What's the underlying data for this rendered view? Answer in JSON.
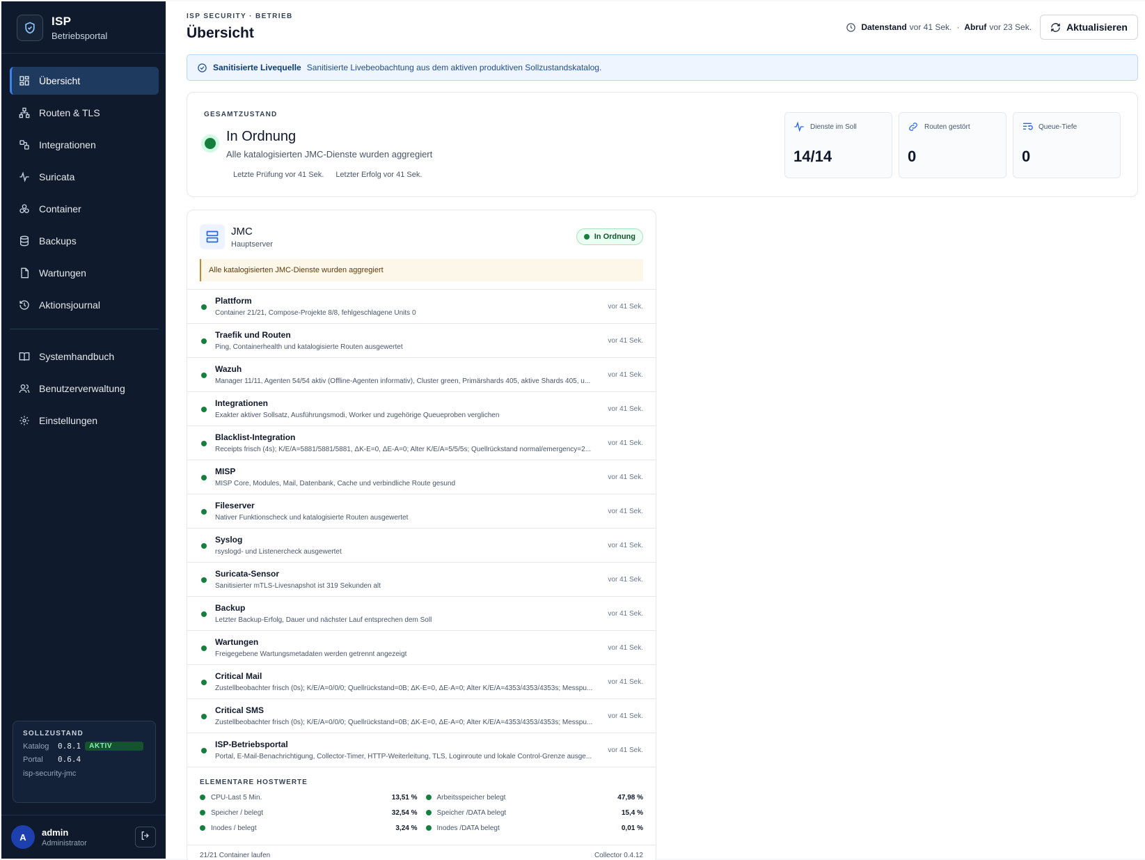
{
  "brand": {
    "title": "ISP",
    "subtitle": "Betriebsportal"
  },
  "nav": {
    "primary": [
      {
        "label": "Übersicht",
        "icon": "dashboard-icon",
        "active": true
      },
      {
        "label": "Routen & TLS",
        "icon": "network-icon"
      },
      {
        "label": "Integrationen",
        "icon": "integrations-icon"
      },
      {
        "label": "Suricata",
        "icon": "activity-icon"
      },
      {
        "label": "Container",
        "icon": "containers-icon"
      },
      {
        "label": "Backups",
        "icon": "database-icon"
      },
      {
        "label": "Wartungen",
        "icon": "document-icon"
      },
      {
        "label": "Aktionsjournal",
        "icon": "history-icon"
      }
    ],
    "secondary": [
      {
        "label": "Systemhandbuch",
        "icon": "book-icon"
      },
      {
        "label": "Benutzerverwaltung",
        "icon": "users-icon"
      },
      {
        "label": "Einstellungen",
        "icon": "gear-icon"
      }
    ]
  },
  "sollzustand": {
    "title": "SOLLZUSTAND",
    "katalog_label": "Katalog",
    "katalog_version": "0.8.1",
    "katalog_badge": "AKTIV",
    "portal_label": "Portal",
    "portal_version": "0.6.4",
    "host": "isp-security-jmc"
  },
  "user": {
    "initial": "A",
    "name": "admin",
    "role": "Administrator"
  },
  "header": {
    "kicker": "ISP SECURITY · BETRIEB",
    "title": "Übersicht",
    "datenstand_label": "Datenstand",
    "datenstand_value": "vor 41 Sek.",
    "sep": "·",
    "abruf_label": "Abruf",
    "abruf_value": "vor 23 Sek.",
    "refresh_label": "Aktualisieren"
  },
  "banner": {
    "title": "Sanitisierte Livequelle",
    "text": "Sanitisierte Livebeobachtung aus dem aktiven produktiven Sollzustandskatalog."
  },
  "overall": {
    "label": "GESAMTZUSTAND",
    "status": "In Ordnung",
    "description": "Alle katalogisierten JMC-Dienste wurden aggregiert",
    "last_check": "Letzte Prüfung vor 41 Sek.",
    "last_success": "Letzter Erfolg vor 41 Sek.",
    "kpis": [
      {
        "label": "Dienste im Soll",
        "value": "14/14",
        "icon": "pulse-icon"
      },
      {
        "label": "Routen gestört",
        "value": "0",
        "icon": "link-icon"
      },
      {
        "label": "Queue-Tiefe",
        "value": "0",
        "icon": "queue-icon"
      }
    ]
  },
  "host": {
    "name": "JMC",
    "role": "Hauptserver",
    "status": "In Ordnung",
    "note": "Alle katalogisierten JMC-Dienste wurden aggregiert",
    "checks": [
      {
        "name": "Plattform",
        "desc": "Container 21/21, Compose-Projekte 8/8, fehlgeschlagene Units 0",
        "time": "vor 41 Sek."
      },
      {
        "name": "Traefik und Routen",
        "desc": "Ping, Containerhealth und katalogisierte Routen ausgewertet",
        "time": "vor 41 Sek."
      },
      {
        "name": "Wazuh",
        "desc": "Manager 11/11, Agenten 54/54 aktiv (Offline-Agenten informativ), Cluster green, Primärshards 405, aktive Shards 405, u...",
        "time": "vor 41 Sek."
      },
      {
        "name": "Integrationen",
        "desc": "Exakter aktiver Sollsatz, Ausführungsmodi, Worker und zugehörige Queueproben verglichen",
        "time": "vor 41 Sek."
      },
      {
        "name": "Blacklist-Integration",
        "desc": "Receipts frisch (4s); K/E/A=5881/5881/5881, ΔK-E=0, ΔE-A=0; Alter K/E/A=5/5/5s; Quellrückstand normal/emergency=2...",
        "time": "vor 41 Sek."
      },
      {
        "name": "MISP",
        "desc": "MISP Core, Modules, Mail, Datenbank, Cache und verbindliche Route gesund",
        "time": "vor 41 Sek."
      },
      {
        "name": "Fileserver",
        "desc": "Nativer Funktionscheck und katalogisierte Routen ausgewertet",
        "time": "vor 41 Sek."
      },
      {
        "name": "Syslog",
        "desc": "rsyslogd- und Listenercheck ausgewertet",
        "time": "vor 41 Sek."
      },
      {
        "name": "Suricata-Sensor",
        "desc": "Sanitisierter mTLS-Livesnapshot ist 319 Sekunden alt",
        "time": "vor 41 Sek."
      },
      {
        "name": "Backup",
        "desc": "Letzter Backup-Erfolg, Dauer und nächster Lauf entsprechen dem Soll",
        "time": "vor 41 Sek."
      },
      {
        "name": "Wartungen",
        "desc": "Freigegebene Wartungsmetadaten werden getrennt angezeigt",
        "time": "vor 41 Sek."
      },
      {
        "name": "Critical Mail",
        "desc": "Zustellbeobachter frisch (0s); K/E/A=0/0/0; Quellrückstand=0B; ΔK-E=0, ΔE-A=0; Alter K/E/A=4353/4353/4353s; Messpu...",
        "time": "vor 41 Sek."
      },
      {
        "name": "Critical SMS",
        "desc": "Zustellbeobachter frisch (0s); K/E/A=0/0/0; Quellrückstand=0B; ΔK-E=0, ΔE-A=0; Alter K/E/A=4353/4353/4353s; Messpu...",
        "time": "vor 41 Sek."
      },
      {
        "name": "ISP-Betriebsportal",
        "desc": "Portal, E-Mail-Benachrichtigung, Collector-Timer, HTTP-Weiterleitung, TLS, Loginroute und lokale Control-Grenze ausge...",
        "time": "vor 41 Sek."
      }
    ],
    "hostvalues_title": "ELEMENTARE HOSTWERTE",
    "hostvalues": [
      {
        "label": "CPU-Last 5 Min.",
        "value": "13,51 %"
      },
      {
        "label": "Arbeitsspeicher belegt",
        "value": "47,98 %"
      },
      {
        "label": "Speicher / belegt",
        "value": "32,54 %"
      },
      {
        "label": "Speicher /DATA belegt",
        "value": "15,4 %"
      },
      {
        "label": "Inodes / belegt",
        "value": "3,24 %"
      },
      {
        "label": "Inodes /DATA belegt",
        "value": "0,01 %"
      }
    ],
    "footer_left": "21/21 Container laufen",
    "footer_right": "Collector 0.4.12"
  },
  "colors": {
    "sidebar": "#0f1b2d",
    "ok": "#15803d",
    "accent": "#3b82f6"
  }
}
